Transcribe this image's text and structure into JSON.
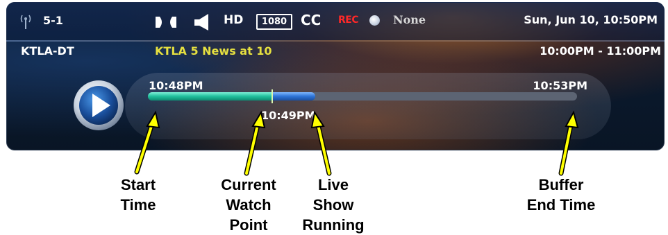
{
  "status_bar": {
    "channel_number": "5-1",
    "resolution": "1080",
    "hd": "HD",
    "cc": "CC",
    "rec": "REC",
    "rec_status": "None",
    "datetime": "Sun, Jun 10, 10:50PM"
  },
  "program": {
    "channel_name": "KTLA-DT",
    "title": "KTLA 5 News at 10",
    "time_range": "10:00PM - 11:00PM"
  },
  "timeline": {
    "start_time": "10:48PM",
    "end_time": "10:53PM",
    "live_time": "10:49PM",
    "buffer_fraction": 0.29,
    "live_fraction": 0.39
  },
  "annotations": [
    {
      "lines": [
        "Start",
        "Time"
      ]
    },
    {
      "lines": [
        "Current",
        "Watch",
        "Point"
      ]
    },
    {
      "lines": [
        "Live",
        "Show",
        "Running"
      ]
    },
    {
      "lines": [
        "Buffer",
        "End Time"
      ]
    }
  ],
  "colors": {
    "arrow": "#ffff00",
    "title": "#e6e040",
    "rec": "#ff2828",
    "buffer_bar": "#1fbf9c",
    "live_bar": "#2d73d6"
  },
  "icons": [
    "antenna-icon",
    "av-sync-icon",
    "speaker-icon",
    "record-dot-icon",
    "play-icon"
  ]
}
